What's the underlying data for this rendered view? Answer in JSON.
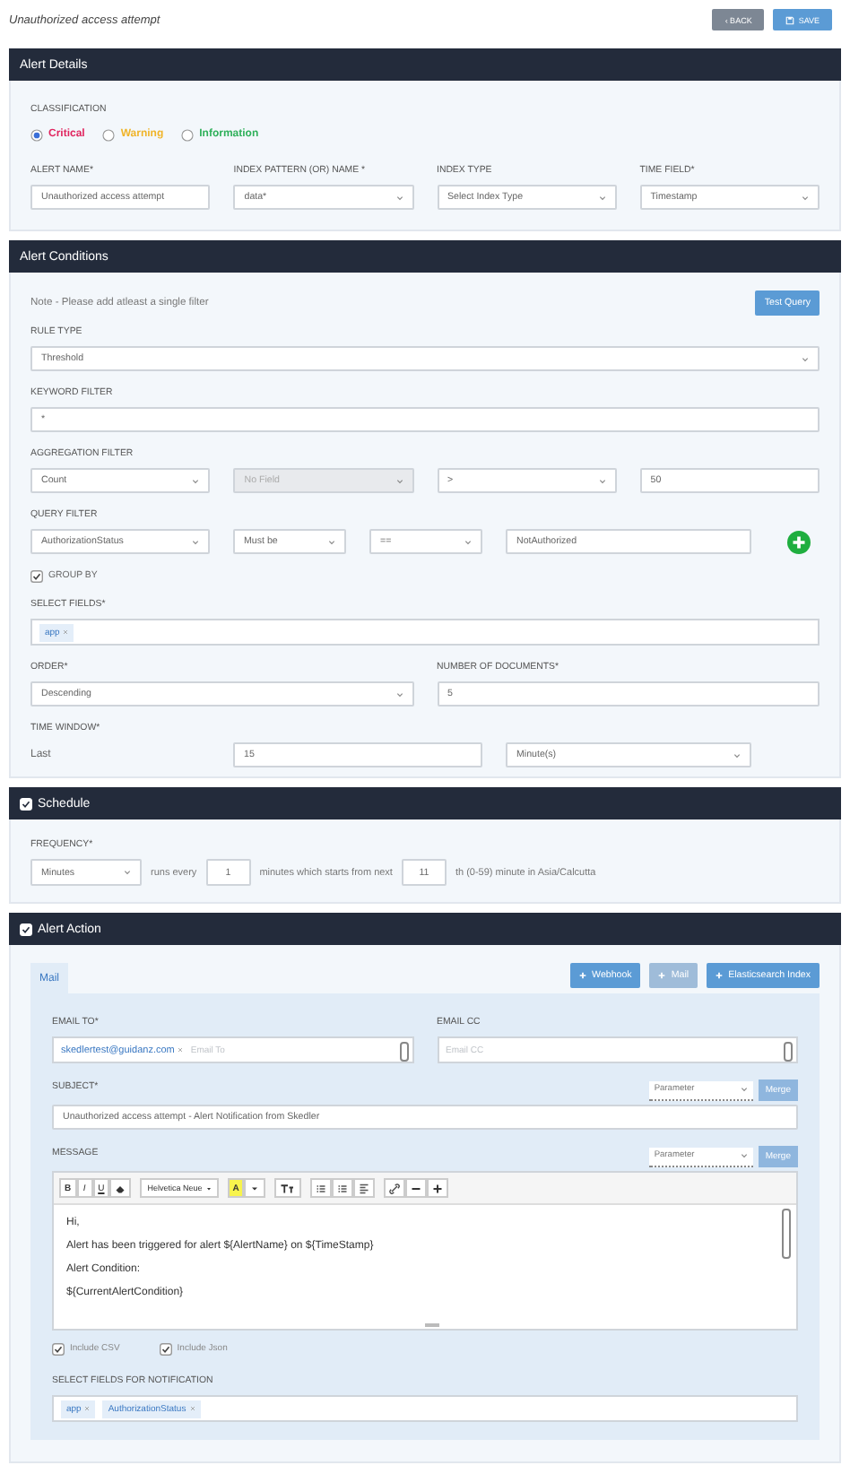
{
  "header": {
    "title": "Unauthorized access attempt",
    "buttons": [
      {
        "label": "‹ BACK",
        "kind": "back"
      },
      {
        "label": "SAVE",
        "kind": "save"
      }
    ]
  },
  "alert_details": {
    "title": "Alert Details",
    "classification_label": "CLASSIFICATION",
    "classifications": [
      {
        "label": "Critical",
        "selected": true,
        "color": "#e0245e"
      },
      {
        "label": "Warning",
        "selected": false,
        "color": "#f0b429"
      },
      {
        "label": "Information",
        "selected": false,
        "color": "#2fb05a"
      }
    ],
    "fields": [
      {
        "label": "ALERT NAME*",
        "control": {
          "kind": "text",
          "value": "Unauthorized access attempt"
        }
      },
      {
        "label": "INDEX PATTERN (OR) NAME *",
        "control": {
          "kind": "select",
          "value": "data*"
        }
      },
      {
        "label": "INDEX TYPE",
        "control": {
          "kind": "select",
          "value": "Select Index Type"
        }
      },
      {
        "label": "TIME FIELD*",
        "control": {
          "kind": "select",
          "value": "Timestamp"
        }
      }
    ]
  },
  "alert_conditions": {
    "title": "Alert Conditions",
    "note": "Note - Please add atleast a single filter",
    "test_button": "Test Query",
    "rule_type": {
      "label": "RULE TYPE",
      "control": {
        "kind": "select",
        "value": "Threshold"
      }
    },
    "keyword_filter": {
      "label": "KEYWORD FILTER",
      "control": {
        "kind": "text",
        "value": "*"
      }
    },
    "aggregation_filter": {
      "label": "AGGREGATION FILTER",
      "controls": [
        {
          "kind": "select",
          "value": "Count",
          "disabled": false
        },
        {
          "kind": "select",
          "value": "No Field",
          "disabled": true
        },
        {
          "kind": "select",
          "value": ">",
          "disabled": false
        },
        {
          "kind": "text",
          "value": "50",
          "disabled": false
        }
      ]
    },
    "query_filter": {
      "label": "QUERY FILTER",
      "controls": [
        {
          "kind": "select",
          "value": "AuthorizationStatus"
        },
        {
          "kind": "select",
          "value": "Must be"
        },
        {
          "kind": "select",
          "value": "=="
        },
        {
          "kind": "text",
          "value": "NotAuthorized"
        }
      ]
    },
    "group_by": {
      "label": "GROUP BY",
      "checked": true
    },
    "select_fields": {
      "label": "SELECT FIELDS*",
      "tags": [
        "app"
      ]
    },
    "order": {
      "label": "ORDER*",
      "control": {
        "kind": "select",
        "value": "Descending"
      }
    },
    "number_of_documents": {
      "label": "NUMBER OF DOCUMENTS*",
      "control": {
        "kind": "text",
        "value": "5"
      }
    },
    "time_window": {
      "label": "TIME WINDOW*",
      "prefix": "Last",
      "controls": [
        {
          "kind": "text",
          "value": "15"
        },
        {
          "kind": "select",
          "value": "Minute(s)"
        }
      ]
    }
  },
  "schedule": {
    "title": "Schedule",
    "checked": true,
    "frequency_label": "FREQUENCY*",
    "parts": [
      {
        "kind": "select",
        "value": "Minutes"
      },
      {
        "kind": "label",
        "value": "runs every"
      },
      {
        "kind": "text",
        "value": "1"
      },
      {
        "kind": "label",
        "value": "minutes which starts from next"
      },
      {
        "kind": "text",
        "value": "11"
      },
      {
        "kind": "label",
        "value": "th (0-59) minute in Asia/Calcutta"
      }
    ]
  },
  "alert_action": {
    "title": "Alert Action",
    "checked": true,
    "tabs": [
      {
        "label": "Mail",
        "selected": true
      }
    ],
    "buttons": [
      {
        "label": "Webhook",
        "disabled": false
      },
      {
        "label": "Mail",
        "disabled": true
      },
      {
        "label": "Elasticsearch Index",
        "disabled": false
      }
    ],
    "mail": {
      "email_to": {
        "label": "EMAIL TO*",
        "tags": [
          "skedlertest@guidanz.com"
        ],
        "placeholder": "Email To"
      },
      "email_cc": {
        "label": "EMAIL CC",
        "placeholder": "Email CC"
      },
      "subject": {
        "label": "SUBJECT*",
        "parameter": "Parameter",
        "merge": "Merge",
        "value": "Unauthorized access attempt - Alert Notification from Skedler"
      },
      "message": {
        "label": "MESSAGE",
        "parameter": "Parameter",
        "merge": "Merge",
        "toolbar": {
          "format_buttons": [
            "B",
            "I",
            "U"
          ],
          "font": "Helvetica Neue",
          "color_label": "A"
        },
        "lines": [
          "Hi,",
          "Alert has been triggered for alert ${AlertName} on ${TimeStamp}",
          "Alert Condition:",
          "${CurrentAlertCondition}"
        ]
      },
      "options": [
        {
          "label": "Include CSV",
          "checked": true
        },
        {
          "label": "Include Json",
          "checked": true
        }
      ],
      "notification_fields": {
        "label": "SELECT FIELDS FOR NOTIFICATION",
        "tags": [
          "app",
          "AuthorizationStatus"
        ]
      }
    }
  }
}
